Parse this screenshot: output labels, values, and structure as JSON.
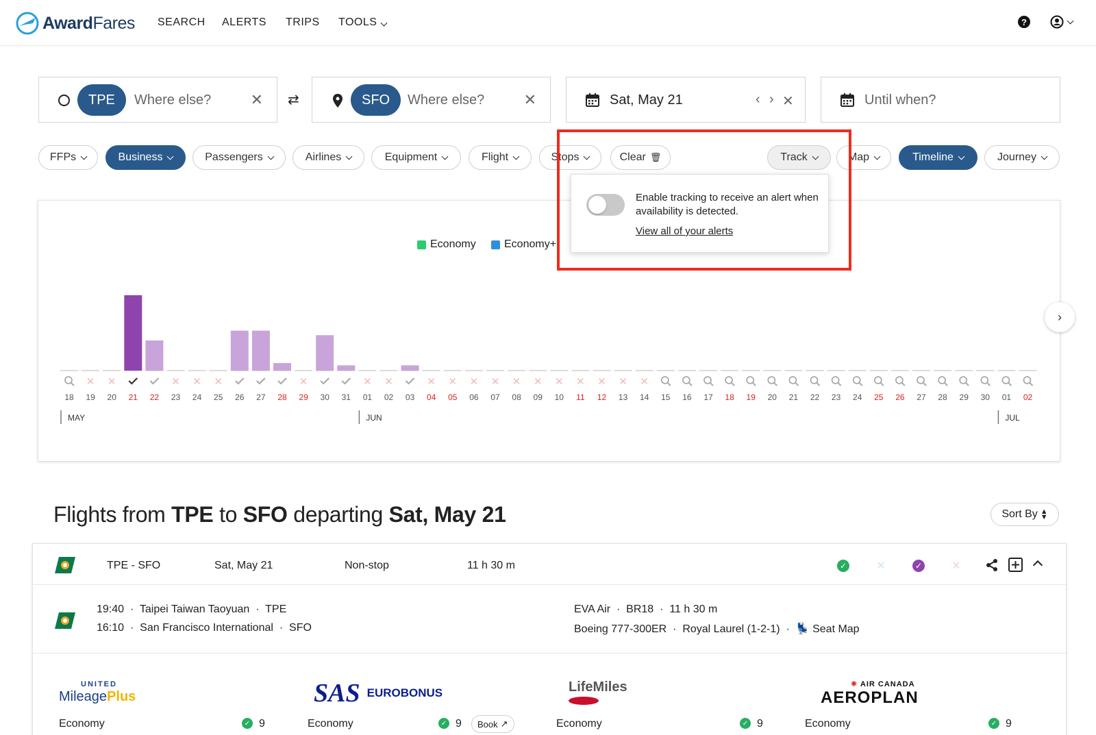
{
  "nav": {
    "brand_award": "Award",
    "brand_fares": "Fares",
    "links": [
      "SEARCH",
      "ALERTS",
      "TRIPS",
      "TOOLS"
    ]
  },
  "search": {
    "origin_code": "TPE",
    "origin_placeholder": "Where else?",
    "dest_code": "SFO",
    "dest_placeholder": "Where else?",
    "date": "Sat, May 21",
    "until_placeholder": "Until when?"
  },
  "filters": {
    "ffps": "FFPs",
    "business": "Business",
    "passengers": "Passengers",
    "airlines": "Airlines",
    "equipment": "Equipment",
    "flight": "Flight",
    "stops": "Stops",
    "clear": "Clear",
    "track": "Track",
    "map": "Map",
    "timeline": "Timeline",
    "journey": "Journey"
  },
  "track_popup": {
    "text": "Enable tracking to receive an alert when availability is detected.",
    "link": "View all of your alerts",
    "enabled": false
  },
  "chart_data": {
    "type": "bar",
    "legend": [
      "Economy",
      "Economy+"
    ],
    "legend_colors": [
      "#2ecc71",
      "#2f8fdc"
    ],
    "dates": [
      "18",
      "19",
      "20",
      "21",
      "22",
      "23",
      "24",
      "25",
      "26",
      "27",
      "28",
      "29",
      "30",
      "31",
      "01",
      "02",
      "03",
      "04",
      "05",
      "06",
      "07",
      "08",
      "09",
      "10",
      "11",
      "12",
      "13",
      "14",
      "15",
      "16",
      "17",
      "18",
      "19",
      "20",
      "21",
      "22",
      "23",
      "24",
      "25",
      "26",
      "27",
      "28",
      "29",
      "30",
      "01",
      "02"
    ],
    "values": [
      0,
      0,
      0,
      100,
      40,
      0,
      0,
      0,
      53,
      53,
      10,
      0,
      47,
      7,
      0,
      0,
      7,
      0,
      0,
      0,
      0,
      0,
      0,
      0,
      0,
      0,
      0,
      0,
      0,
      0,
      0,
      0,
      0,
      0,
      0,
      0,
      0,
      0,
      0,
      0,
      0,
      0,
      0,
      0,
      0,
      0
    ],
    "selected_index": 3,
    "status": [
      "q",
      "x",
      "x",
      "check-dark",
      "check",
      "x",
      "x",
      "x",
      "check",
      "check",
      "check",
      "x",
      "check",
      "check",
      "x",
      "x",
      "check",
      "x",
      "x",
      "x",
      "x",
      "x",
      "x",
      "x",
      "x",
      "x",
      "x",
      "x",
      "q",
      "q",
      "q",
      "q",
      "q",
      "q",
      "q",
      "q",
      "q",
      "q",
      "q",
      "q",
      "q",
      "q",
      "q",
      "q",
      "q",
      "q"
    ],
    "red_dates": [
      3,
      4,
      10,
      11,
      17,
      18,
      24,
      25,
      31,
      32,
      38,
      39,
      45
    ],
    "months": [
      {
        "label": "MAY",
        "index": 0
      },
      {
        "label": "JUN",
        "index": 14
      },
      {
        "label": "JUL",
        "index": 44
      }
    ],
    "colors": {
      "selected": "#8e44ad",
      "other": "#c9a4da"
    }
  },
  "results": {
    "title_prefix": "Flights from ",
    "origin": "TPE",
    "to": " to ",
    "dest": "SFO",
    "departing": " departing ",
    "date": "Sat, May 21",
    "sort_label": "Sort By"
  },
  "flight": {
    "route": "TPE - SFO",
    "date": "Sat, May 21",
    "stops": "Non-stop",
    "duration": "11 h 30 m",
    "dep_time": "19:40",
    "dep_airport": "Taipei Taiwan Taoyuan",
    "dep_code": "TPE",
    "arr_time": "16:10",
    "arr_airport": "San Francisco International",
    "arr_code": "SFO",
    "airline": "EVA Air",
    "flight_no": "BR18",
    "flight_duration": "11 h 30 m",
    "aircraft": "Boeing 777-300ER",
    "cabin": "Royal Laurel (1-2-1)",
    "seat_map": "Seat Map"
  },
  "programs": [
    {
      "name_top": "UNITED",
      "name_main": "Mileage",
      "name_accent": "Plus",
      "cabin": "Economy",
      "count": "9"
    },
    {
      "name_main": "SAS",
      "name_accent": "EUROBONUS",
      "cabin": "Economy",
      "count": "9",
      "book": "Book"
    },
    {
      "name_main": "LifeMiles",
      "cabin": "Economy",
      "count": "9"
    },
    {
      "name_top": "AIR CANADA",
      "name_main": "AEROPLAN",
      "cabin": "Economy",
      "count": "9"
    }
  ]
}
